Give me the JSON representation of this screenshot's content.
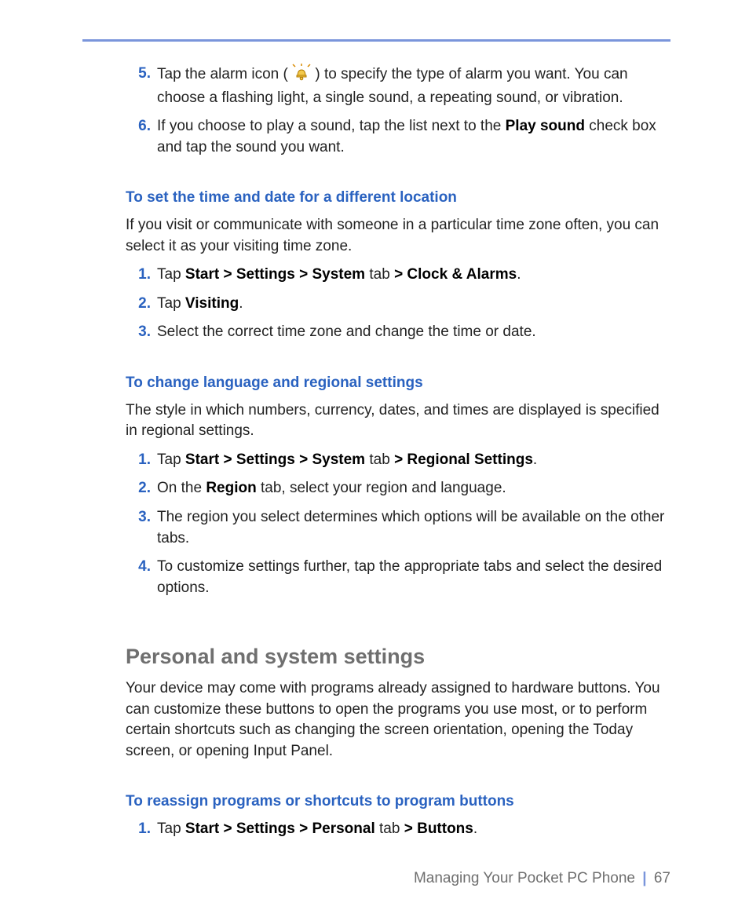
{
  "list1": {
    "n5": "5.",
    "i5a": "Tap the alarm icon (",
    "i5b": ") to specify the type of alarm you want. You can choose a flashing light, a single sound, a repeating sound, or vibration.",
    "n6": "6.",
    "i6a": "If you choose to play a sound, tap the list next to the ",
    "i6b": "Play sound",
    "i6c": " check box and tap the sound you want."
  },
  "s1": {
    "head": "To set the time and date for a different location",
    "para": "If you visit or communicate with someone in a particular time zone often, you can select it as your visiting time zone.",
    "n1": "1.",
    "i1a": "Tap ",
    "i1b": "Start > Settings > System",
    "i1c": " tab ",
    "i1d": "> Clock & Alarms",
    "i1e": ".",
    "n2": "2.",
    "i2a": "Tap ",
    "i2b": "Visiting",
    "i2c": ".",
    "n3": "3.",
    "i3": "Select the correct time zone and change the time or date."
  },
  "s2": {
    "head": "To change language and regional settings",
    "para": "The style in which numbers, currency, dates, and times are displayed is specified in regional settings.",
    "n1": "1.",
    "i1a": "Tap ",
    "i1b": "Start > Settings > System",
    "i1c": " tab ",
    "i1d": "> Regional Settings",
    "i1e": ".",
    "n2": "2.",
    "i2a": "On the ",
    "i2b": "Region",
    "i2c": " tab, select your region and language.",
    "n3": "3.",
    "i3": "The region you select determines which options will be available on the other tabs.",
    "n4": "4.",
    "i4": "To customize settings further, tap the appropriate tabs and select the desired options."
  },
  "s3": {
    "title": "Personal and system settings",
    "para": "Your device may come with programs already assigned to hardware buttons. You can customize these buttons to open the programs you use most, or to perform certain shortcuts such as changing the screen orientation, opening the Today screen, or opening Input Panel.",
    "head": "To reassign programs or shortcuts to program buttons",
    "n1": "1.",
    "i1a": "Tap ",
    "i1b": "Start > Settings > Personal",
    "i1c": " tab ",
    "i1d": "> Buttons",
    "i1e": "."
  },
  "footer": {
    "chapter": "Managing Your Pocket PC Phone",
    "page": "67"
  }
}
